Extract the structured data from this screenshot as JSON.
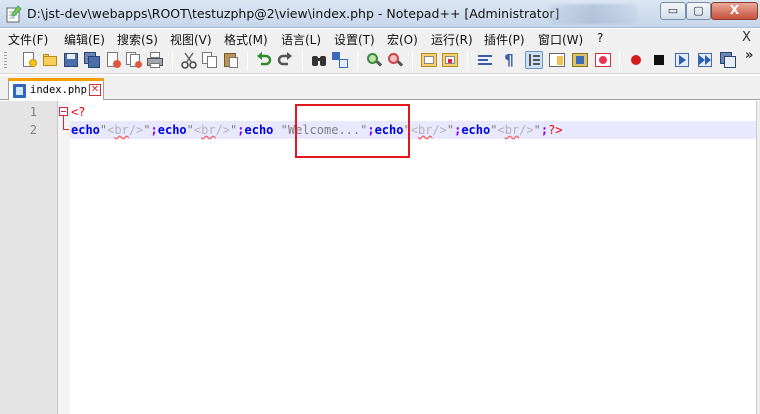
{
  "window": {
    "title": "D:\\jst-dev\\webapps\\ROOT\\testuzphp@2\\view\\index.php - Notepad++ [Administrator]",
    "minimize_label": "▭",
    "maximize_label": "▢",
    "close_label": "X"
  },
  "menu": {
    "items": [
      "文件(F)",
      "编辑(E)",
      "搜索(S)",
      "视图(V)",
      "格式(M)",
      "语言(L)",
      "设置(T)",
      "宏(O)",
      "运行(R)",
      "插件(P)",
      "窗口(W)",
      "?"
    ],
    "close_label": "X"
  },
  "toolbar": {
    "more_label": "»",
    "icons": [
      "new-file-icon",
      "open-file-icon",
      "save-icon",
      "save-all-icon",
      "close-icon",
      "close-all-icon",
      "print-icon",
      "cut-icon",
      "copy-icon",
      "paste-icon",
      "undo-icon",
      "redo-icon",
      "find-icon",
      "replace-icon",
      "zoom-in-icon",
      "zoom-out-icon",
      "sync-vertical-icon",
      "sync-horizontal-icon",
      "word-wrap-icon",
      "show-all-characters-icon",
      "indent-guide-icon",
      "document-map-icon",
      "function-list-icon",
      "folder-workspace-icon",
      "record-macro-icon",
      "stop-recording-icon",
      "play-macro-icon",
      "run-macro-multiple-icon",
      "save-macro-icon"
    ]
  },
  "tabs": [
    {
      "label": "index.php",
      "close_label": "✕"
    }
  ],
  "editor": {
    "line_numbers": [
      "1",
      "2"
    ],
    "line1": {
      "text": "<?"
    },
    "line2": {
      "t1": "echo",
      "t2": "\"",
      "t3": "<",
      "t4": "br",
      "t5": "/>",
      "t6": "\"",
      "t7": ";",
      "t8": "echo",
      "t9": "\"",
      "t10": "<",
      "t11": "br",
      "t12": "/>",
      "t13": "\"",
      "t14": ";",
      "t15": "echo",
      "t16": " ",
      "t17": "\"Welcome...\"",
      "t18": ";",
      "t19": "echo",
      "t20": "\"",
      "t21": "<",
      "t22": "br",
      "t23": "/>",
      "t24": "\"",
      "t25": ";",
      "t26": "echo",
      "t27": "\"",
      "t28": "<",
      "t29": "br",
      "t30": "/>",
      "t31": "\"",
      "t32": ";",
      "t33": "?>"
    }
  },
  "colors": {
    "keyword": "#0000e6",
    "operator": "#8000ff",
    "php_delim": "#ff0000",
    "string": "#808080",
    "html_tag": "#b4b4b4",
    "highlight_box": "#e3181f",
    "active_tab_accent": "#f3a000"
  }
}
